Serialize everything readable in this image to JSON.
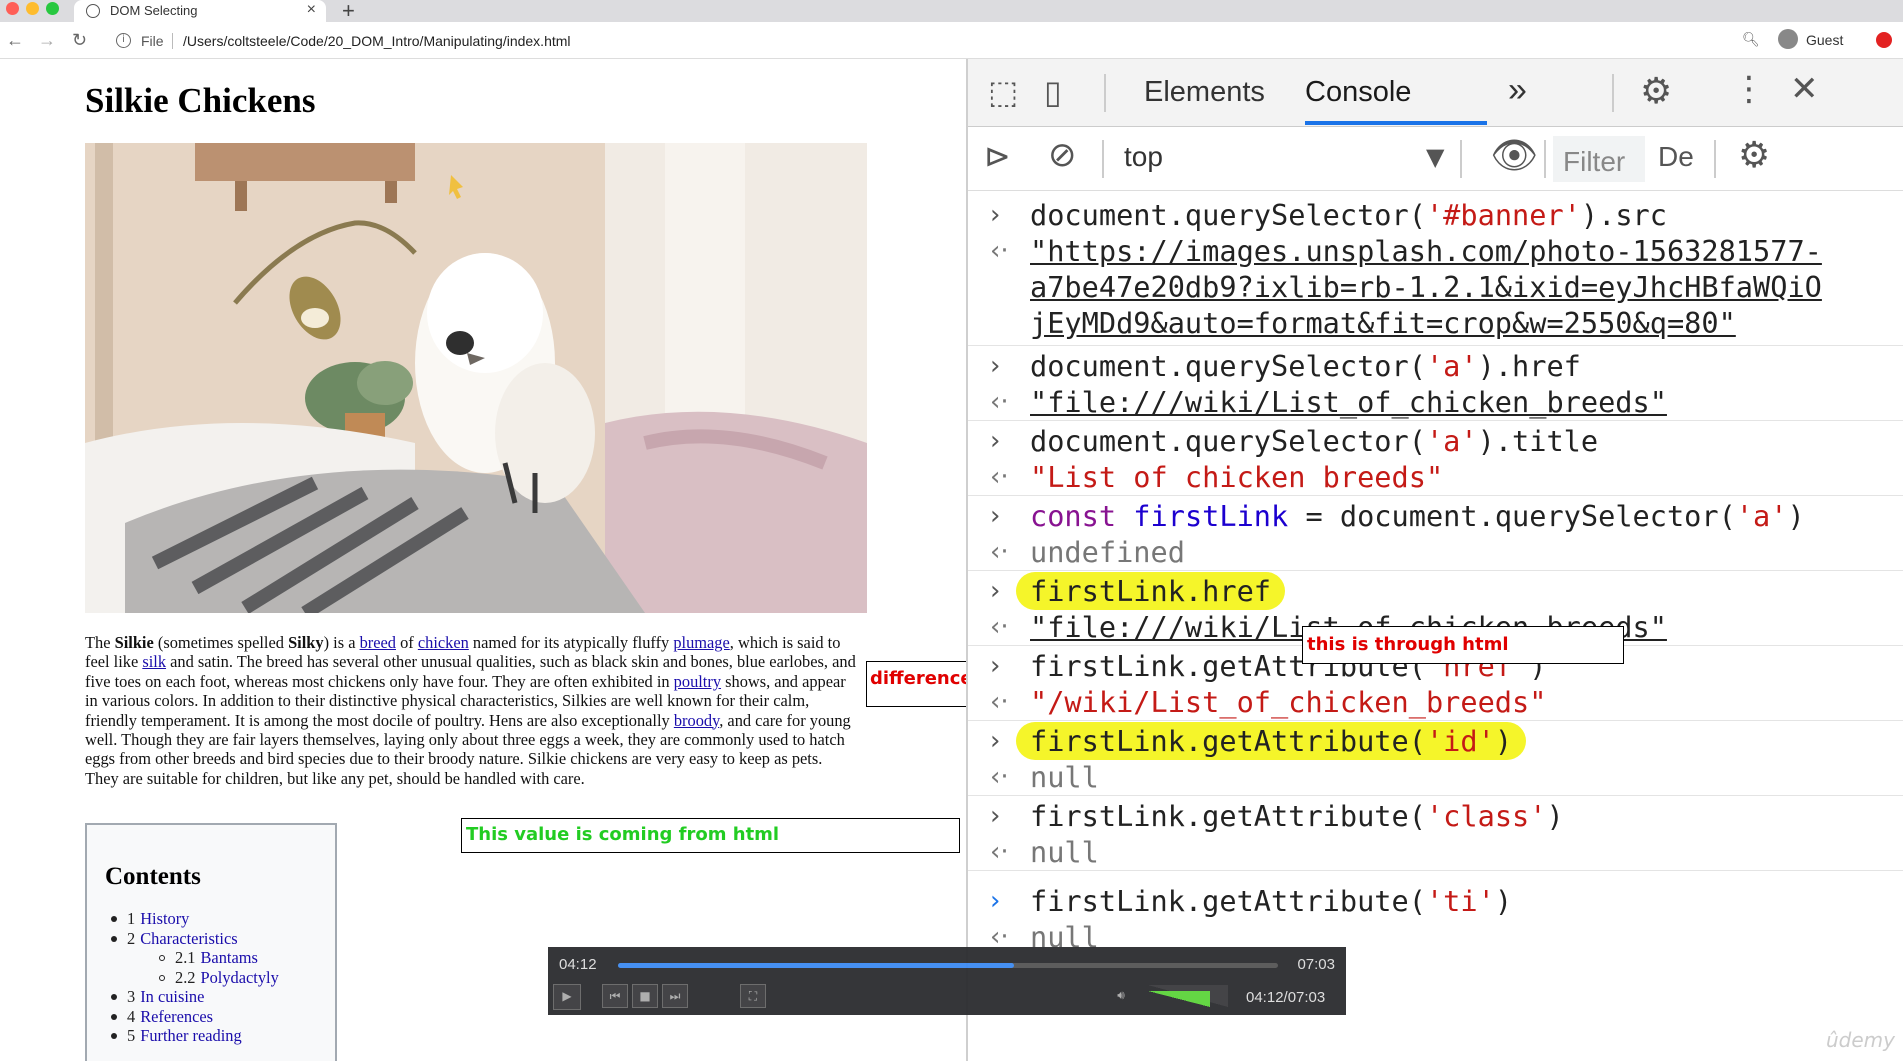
{
  "browser": {
    "tab_title": "DOM Selecting",
    "tab_close": "×",
    "new_tab": "+",
    "url_scheme_label": "File",
    "url_path": "/Users/coltsteele/Code/20_DOM_Intro/Manipulating/index.html",
    "profile_label": "Guest",
    "colors": {
      "close": "#ff5f57",
      "minimize": "#febc2e",
      "maximize": "#28c840"
    }
  },
  "page": {
    "title": "Silkie Chickens",
    "paragraph": {
      "t1": "The ",
      "silkie": "Silkie",
      "t2": " (sometimes spelled ",
      "silky": "Silky",
      "t3": ") is a ",
      "breed": "breed",
      "t4": " of ",
      "chicken": "chicken",
      "t5": " named for its atypically fluffy ",
      "plumage": "plumage",
      "t6": ", which is said to feel like ",
      "silk": "silk",
      "t7": " and satin. The breed has several other unusual qualities, such as black skin and bones, blue earlobes, and five toes on each foot, whereas most chickens only have four. They are often exhibited in ",
      "poultry": "poultry",
      "t8": " shows, and appear in various colors. In addition to their distinctive physical characteristics, Silkies are well known for their calm, friendly temperament. It is among the most docile of poultry. Hens are also exceptionally ",
      "broody": "broody",
      "t9": ", and care for young well. Though they are fair layers themselves, laying only about three eggs a week, they are commonly used to hatch eggs from other breeds and bird species due to their broody nature. Silkie chickens are very easy to keep as pets. They are suitable for children, but like any pet, should be handled with care."
    },
    "toc": {
      "heading": "Contents",
      "items": [
        {
          "num": "1",
          "label": "History",
          "sub": false
        },
        {
          "num": "2",
          "label": "Characteristics",
          "sub": false
        },
        {
          "num": "2.1",
          "label": "Bantams",
          "sub": true
        },
        {
          "num": "2.2",
          "label": "Polydactyly",
          "sub": true
        },
        {
          "num": "3",
          "label": "In cuisine",
          "sub": false
        },
        {
          "num": "4",
          "label": "References",
          "sub": false
        },
        {
          "num": "5",
          "label": "Further reading",
          "sub": false
        }
      ]
    }
  },
  "annotations": {
    "difference": "difference",
    "from_html": "This value is coming from html",
    "through_html": "this is through html"
  },
  "devtools": {
    "tabs": {
      "elements": "Elements",
      "console": "Console",
      "more": "»"
    },
    "context": "top",
    "filter_placeholder": "Filter",
    "levels_truncated": "De",
    "entries": [
      {
        "input": {
          "a": "document.querySelector(",
          "b": "'#banner'",
          "c": ").src"
        },
        "output": [
          "\"https://images.unsplash.com/photo-1563281577-",
          "a7be47e20db9?ixlib=rb-1.2.1&ixid=eyJhcHBfaWQiO",
          "jEyMDd9&auto=format&fit=crop&w=2550&q=80\""
        ]
      },
      {
        "input": {
          "a": "document.querySelector(",
          "b": "'a'",
          "c": ").href"
        },
        "output": "\"file:///wiki/List_of_chicken_breeds\""
      },
      {
        "input": {
          "a": "document.querySelector(",
          "b": "'a'",
          "c": ").title"
        },
        "output": "\"List of chicken breeds\""
      },
      {
        "input": {
          "kw": "const",
          "var": "firstLink",
          "eq": " = document.querySelector(",
          "b": "'a'",
          "c": ")"
        },
        "output": "undefined"
      },
      {
        "input": "firstLink.href",
        "output": "\"file:///wiki/List_of_chicken_breeds\""
      },
      {
        "input": {
          "a": "firstLink.getAttribute(",
          "b": "'href'",
          "c": ")"
        },
        "output": "\"/wiki/List_of_chicken_breeds\""
      },
      {
        "input": {
          "a": "firstLink.getAttribute(",
          "b": "'id'",
          "c": ")"
        },
        "output": "null"
      },
      {
        "input": {
          "a": "firstLink.getAttribute(",
          "b": "'class'",
          "c": ")"
        },
        "output": "null"
      },
      {
        "input": {
          "a": "firstLink.getAttribute(",
          "b": "'ti'",
          "c": ")"
        },
        "output": "null"
      }
    ]
  },
  "video": {
    "current": "04:12",
    "duration": "07:03",
    "position_label": "04:12/07:03",
    "progress": 0.6
  },
  "watermark": "ûdemy"
}
